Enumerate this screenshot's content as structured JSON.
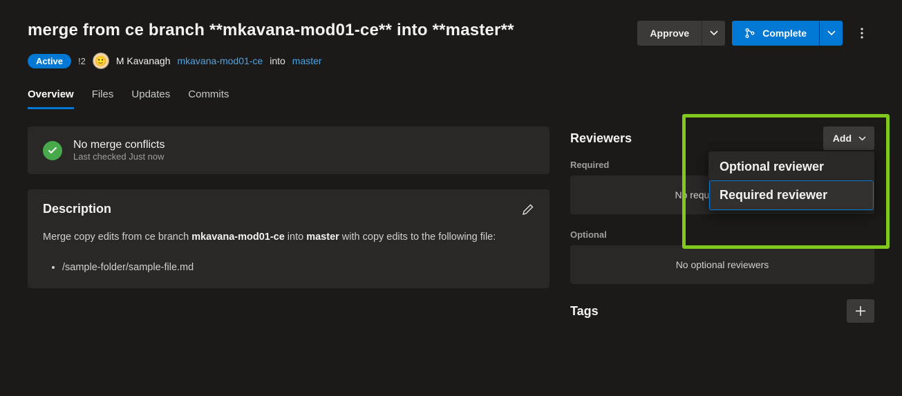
{
  "title": "merge from ce branch **mkavana-mod01-ce** into **master**",
  "actions": {
    "approve": "Approve",
    "complete": "Complete"
  },
  "meta": {
    "status": "Active",
    "id": "!2",
    "author": "M Kavanagh",
    "source_branch": "mkavana-mod01-ce",
    "into": "into",
    "target_branch": "master"
  },
  "tabs": {
    "overview": "Overview",
    "files": "Files",
    "updates": "Updates",
    "commits": "Commits"
  },
  "merge_status": {
    "title": "No merge conflicts",
    "subtitle": "Last checked Just now"
  },
  "description": {
    "heading": "Description",
    "text_prefix": "Merge copy edits from ce branch ",
    "branch1": "mkavana-mod01-ce",
    "mid": " into ",
    "branch2": "master",
    "text_suffix": " with copy edits to the following file:",
    "file": "/sample-folder/sample-file.md"
  },
  "reviewers": {
    "heading": "Reviewers",
    "add": "Add",
    "required_label": "Required",
    "required_empty": "No required reviewers",
    "optional_label": "Optional",
    "optional_empty": "No optional reviewers",
    "menu": {
      "optional": "Optional reviewer",
      "required": "Required reviewer"
    }
  },
  "tags": {
    "heading": "Tags"
  }
}
